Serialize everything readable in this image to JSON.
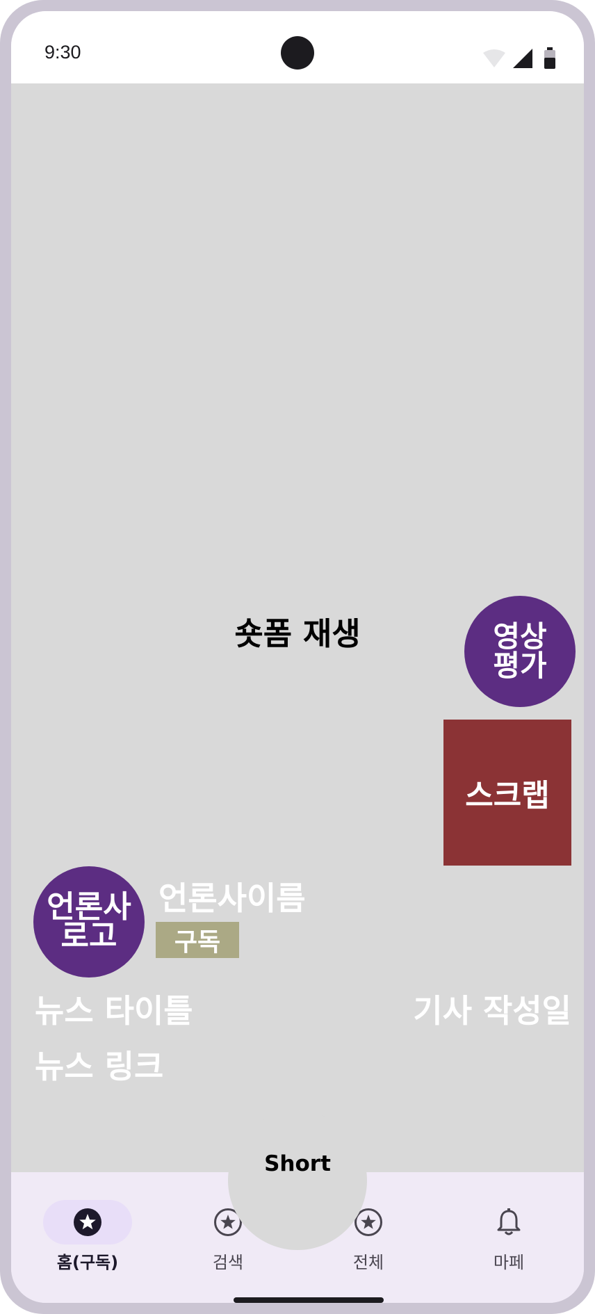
{
  "status_bar": {
    "time": "9:30"
  },
  "video": {
    "label": "숏폼 재생"
  },
  "actions": {
    "rate_label": "영상 평가",
    "scrap_label": "스크랩"
  },
  "press": {
    "logo_label": "언론사 로고",
    "name": "언론사이름",
    "subscribe_label": "구독"
  },
  "news": {
    "title": "뉴스 타이틀",
    "date": "기사 작성일",
    "link": "뉴스 링크"
  },
  "short_button": {
    "label": "Short"
  },
  "bottom_nav": {
    "items": [
      {
        "label": "홈(구독)",
        "icon": "star-icon",
        "active": true
      },
      {
        "label": "검색",
        "icon": "star-icon",
        "active": false
      },
      {
        "label": "전체",
        "icon": "star-icon",
        "active": false
      },
      {
        "label": "마페",
        "icon": "bell-icon",
        "active": false
      }
    ]
  },
  "colors": {
    "purple": "#5c2d82",
    "scrap_red": "#8b3335",
    "subscribe_olive": "#aba985",
    "nav_background": "#f0eaf6",
    "active_pill": "#e8def8",
    "video_gray": "#d9d9d9"
  }
}
